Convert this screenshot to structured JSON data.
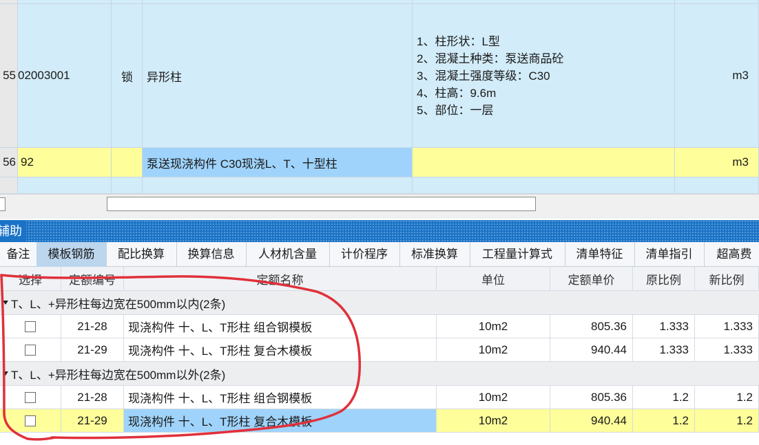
{
  "top_rows": [
    {
      "row_no": "55",
      "code": "02003001",
      "lock": "锁",
      "name": "异形柱",
      "features": [
        "1、柱形状：L型",
        "2、混凝土种类：泵送商品砼",
        "3、混凝土强度等级：C30",
        "4、柱高：9.6m",
        "5、部位：一层"
      ],
      "unit": "m3"
    },
    {
      "row_no": "56",
      "code": "92",
      "lock": "",
      "name": "泵送现浇构件  C30现浇L、T、十型柱",
      "features": [],
      "unit": "m3"
    }
  ],
  "panel": {
    "title": "辅助"
  },
  "tabs": [
    "备注",
    "模板钢筋",
    "配比换算",
    "换算信息",
    "人材机含量",
    "计价程序",
    "标准换算",
    "工程量计算式",
    "清单特征",
    "清单指引",
    "超高费"
  ],
  "active_tab": "模板钢筋",
  "table": {
    "headers": [
      "选择",
      "定额编号",
      "定额名称",
      "单位",
      "定额单价",
      "原比例",
      "新比例"
    ],
    "groups": [
      {
        "title": "T、L、+异形柱每边宽在500mm以内(2条)",
        "rows": [
          {
            "code": "21-28",
            "name": "现浇构件  十、L、T形柱 组合钢模板",
            "unit": "10m2",
            "price": "805.36",
            "orig": "1.333",
            "new": "1.333"
          },
          {
            "code": "21-29",
            "name": "现浇构件  十、L、T形柱 复合木模板",
            "unit": "10m2",
            "price": "940.44",
            "orig": "1.333",
            "new": "1.333"
          }
        ]
      },
      {
        "title": "T、L、+异形柱每边宽在500mm以外(2条)",
        "rows": [
          {
            "code": "21-28",
            "name": "现浇构件  十、L、T形柱 组合钢模板",
            "unit": "10m2",
            "price": "805.36",
            "orig": "1.2",
            "new": "1.2"
          },
          {
            "code": "21-29",
            "name": "现浇构件  十、L、T形柱 复合木模板",
            "unit": "10m2",
            "price": "940.44",
            "orig": "1.2",
            "new": "1.2"
          }
        ]
      }
    ]
  },
  "colors": {
    "row_blue": "#d2ecf9",
    "row_yellow": "#fefe9a",
    "selected": "#9fd3fb",
    "panel_header": "#1a73c6",
    "annotation": "#e0303a"
  }
}
